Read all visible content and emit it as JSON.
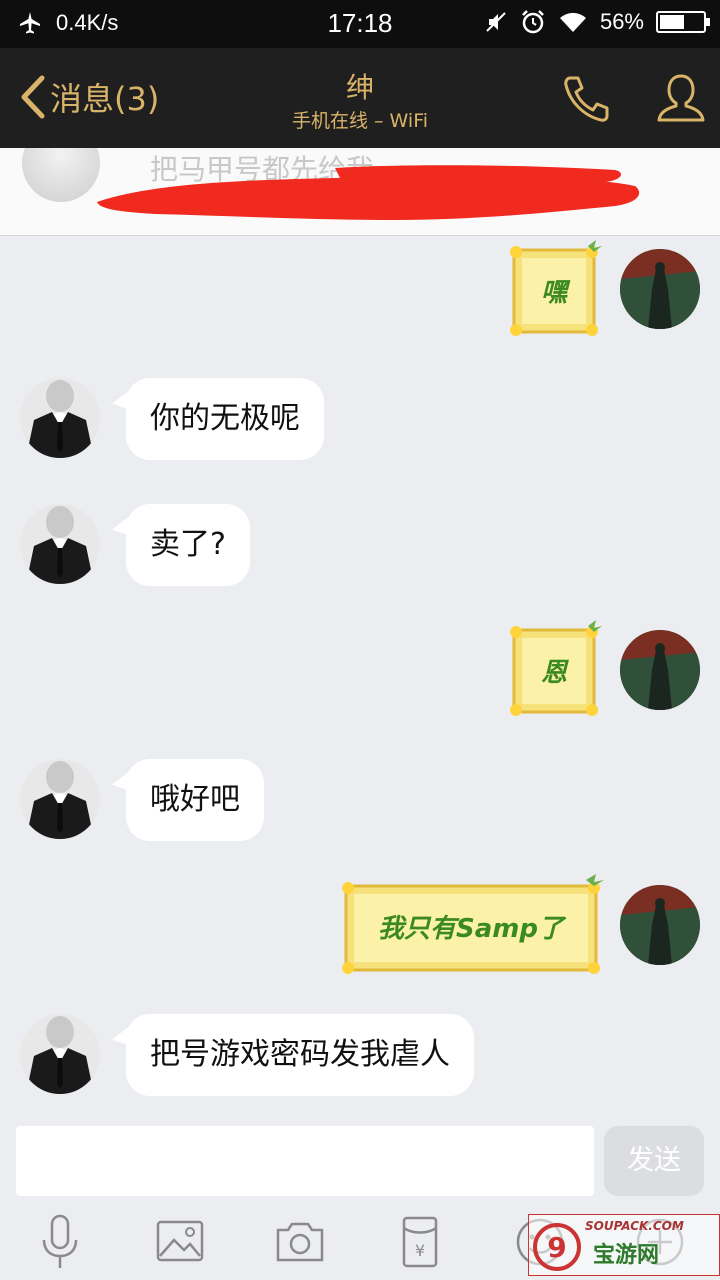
{
  "status_bar": {
    "net_speed": "0.4K/s",
    "time": "17:18",
    "battery_percent": "56%",
    "battery_level": 0.56,
    "icons": [
      "airplane-icon",
      "mute-icon",
      "alarm-icon",
      "wifi-icon",
      "battery-icon"
    ]
  },
  "header": {
    "back_label": "消息(3)",
    "title": "绅",
    "subtitle": "手机在线 – WiFi",
    "accent_color": "#d9b468",
    "icons": [
      "phone-icon",
      "profile-icon"
    ]
  },
  "pinned": {
    "text": "把马甲号都先给我"
  },
  "messages": [
    {
      "side": "right",
      "type": "sticker",
      "text": "嘿"
    },
    {
      "side": "left",
      "type": "text",
      "text": "你的无极呢"
    },
    {
      "side": "left",
      "type": "text",
      "text": "卖了?"
    },
    {
      "side": "right",
      "type": "sticker",
      "text": "恩"
    },
    {
      "side": "left",
      "type": "text",
      "text": "哦好吧"
    },
    {
      "side": "right",
      "type": "sticker",
      "text": "我只有Samp了"
    },
    {
      "side": "left",
      "type": "text",
      "text": "把号游戏密码发我虐人"
    }
  ],
  "input": {
    "value": "",
    "send_label": "发送"
  },
  "toolbar": {
    "icons": [
      "microphone-icon",
      "image-icon",
      "camera-icon",
      "red-packet-icon",
      "emoji-icon",
      "plus-icon"
    ]
  },
  "watermark": {
    "small_text": "SOUPACK.COM",
    "big_text": "宝游网"
  }
}
